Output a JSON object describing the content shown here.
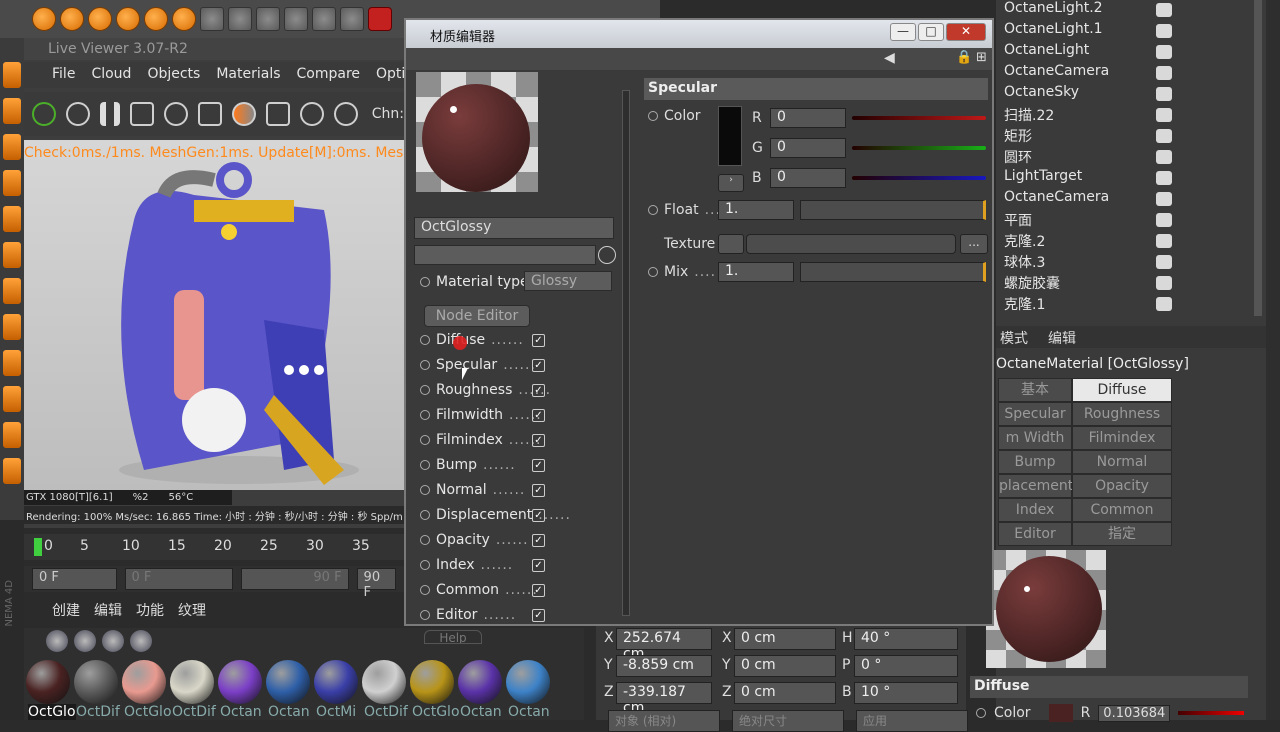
{
  "viewer": {
    "title": "Live Viewer 3.07-R2",
    "menu": [
      "File",
      "Cloud",
      "Objects",
      "Materials",
      "Compare",
      "Option"
    ],
    "channel_label": "Chn:",
    "status": "Check:0ms./1ms. MeshGen:1ms. Update[M]:0ms. Mesh:4",
    "gpu": [
      "GTX 1080[T][6.1]",
      "%2",
      "56°C"
    ],
    "render_line": "Rendering: 100%   Ms/sec: 16.865   Time: 小时 : 分钟 : 秒/小时 : 分钟 : 秒   Spp/m",
    "timeline_ticks": [
      "0",
      "5",
      "10",
      "15",
      "20",
      "25",
      "30",
      "35"
    ],
    "frame_fields": [
      "0 F",
      "0 F",
      "90 F",
      "90 F"
    ]
  },
  "material_tabs": [
    "创建",
    "编辑",
    "功能",
    "纹理"
  ],
  "material_labels": [
    "OctGlo",
    "OctDif",
    "OctGlo",
    "OctDif",
    "Octan",
    "Octan",
    "OctMi",
    "OctDif",
    "OctGlo",
    "Octan",
    "Octan"
  ],
  "material_colors": [
    "#4a2222",
    "#5c5c5c",
    "#e89a90",
    "#d9d7c8",
    "#7b3fc7",
    "#2e5fa8",
    "#3a3fa8",
    "#d0d0d0",
    "#b89418",
    "#5a32a8",
    "#3d82c8"
  ],
  "coords": {
    "rows": [
      {
        "a": "X",
        "av": "252.674 cm",
        "b": "X",
        "bv": "0 cm",
        "c": "H",
        "cv": "40 °"
      },
      {
        "a": "Y",
        "av": "-8.859 cm",
        "b": "Y",
        "bv": "0 cm",
        "c": "P",
        "cv": "0 °"
      },
      {
        "a": "Z",
        "av": "-339.187 cm",
        "b": "Z",
        "bv": "0 cm",
        "c": "B",
        "cv": "10 °"
      }
    ],
    "bottom": [
      "对象 (相对)",
      "绝对尺寸",
      "应用"
    ]
  },
  "dialog": {
    "title": "材质编辑器",
    "material_name": "OctGlossy",
    "material_type_label": "Material type",
    "material_type_value": "Glossy",
    "node_editor": "Node Editor",
    "channels": [
      "Diffuse",
      "Specular",
      "Roughness",
      "Filmwidth",
      "Filmindex",
      "Bump",
      "Normal",
      "Displacement",
      "Opacity",
      "Index",
      "Common",
      "Editor"
    ],
    "help": "Help",
    "section": "Specular",
    "color_label": "Color",
    "rgb": [
      {
        "ch": "R",
        "v": "0",
        "c": "#c01818"
      },
      {
        "ch": "G",
        "v": "0",
        "c": "#18b018"
      },
      {
        "ch": "B",
        "v": "0",
        "c": "#1818c0"
      }
    ],
    "float_label": "Float",
    "float_value": "1.",
    "texture_label": "Texture",
    "texture_btn": "...",
    "mix_label": "Mix",
    "mix_value": "1."
  },
  "objects": [
    "OctaneLight.2",
    "OctaneLight.1",
    "OctaneLight",
    "OctaneCamera",
    "OctaneSky",
    "扫描.22",
    "矩形",
    "圆环",
    "LightTarget",
    "OctaneCamera",
    "平面",
    "克隆.2",
    "球体.3",
    "螺旋胶囊",
    "克隆.1"
  ],
  "attr": {
    "mode_label": "模式",
    "edit_label": "编辑",
    "material_title": "OctaneMaterial [OctGlossy]",
    "tabs": [
      [
        "基本",
        "Diffuse"
      ],
      [
        "Specular",
        "Roughness"
      ],
      [
        "m Width",
        "Filmindex"
      ],
      [
        "Bump",
        "Normal"
      ],
      [
        "placement",
        "Opacity"
      ],
      [
        "Index",
        "Common"
      ],
      [
        "Editor",
        "指定"
      ]
    ],
    "section": "Diffuse",
    "color_label": "Color",
    "r_label": "R",
    "r_value": "0.103684"
  },
  "brand_side": "NEMA 4D"
}
